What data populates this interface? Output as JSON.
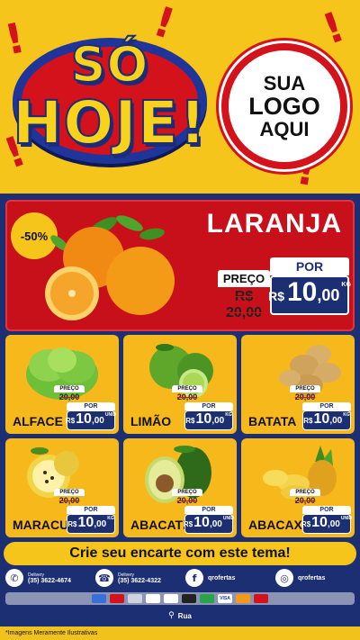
{
  "header": {
    "headline_line1": "SÓ",
    "headline_line2": "HOJE!",
    "logo_line1": "SUA",
    "logo_line2": "LOGO",
    "logo_line3": "AQUI"
  },
  "featured": {
    "name": "LARANJA",
    "discount": "-50%",
    "price_label": "PREÇO",
    "old_price": "R$ 20,00",
    "por_label": "POR",
    "currency": "R$",
    "price_int": "10",
    "price_dec": ",00",
    "unit": "KG"
  },
  "products": [
    {
      "name": "ALFACE",
      "price_label": "PREÇO",
      "old_price": "20,00",
      "por_label": "POR",
      "currency": "R$",
      "price_int": "10",
      "price_dec": ",00",
      "unit": "UNID"
    },
    {
      "name": "LIMÃO",
      "price_label": "PREÇO",
      "old_price": "20,00",
      "por_label": "POR",
      "currency": "R$",
      "price_int": "10",
      "price_dec": ",00",
      "unit": "KG"
    },
    {
      "name": "BATATA",
      "price_label": "PREÇO",
      "old_price": "20,00",
      "por_label": "POR",
      "currency": "R$",
      "price_int": "10",
      "price_dec": ",00",
      "unit": "KG"
    },
    {
      "name": "MARACUJÁ",
      "price_label": "PREÇO",
      "old_price": "20,00",
      "por_label": "POR",
      "currency": "R$",
      "price_int": "10",
      "price_dec": ",00",
      "unit": "KG"
    },
    {
      "name": "ABACATE",
      "price_label": "PREÇO",
      "old_price": "20,00",
      "por_label": "POR",
      "currency": "R$",
      "price_int": "10",
      "price_dec": ",00",
      "unit": "UNID"
    },
    {
      "name": "ABACAXI",
      "price_label": "PREÇO",
      "old_price": "20,00",
      "por_label": "POR",
      "currency": "R$",
      "price_int": "10",
      "price_dec": ",00",
      "unit": "UNID"
    }
  ],
  "cta": "Crie seu encarte com este tema!",
  "contacts": {
    "whatsapp_label": "Delivery",
    "whatsapp_value": "(35) 3622-4674",
    "phone_label": "Delivery",
    "phone_value": "(35) 3622-4322",
    "facebook_value": "qrofertas",
    "instagram_value": "qrofertas"
  },
  "payments": [
    "",
    "",
    "",
    "",
    "",
    "",
    "",
    "VISA",
    "",
    ""
  ],
  "address": "Rua",
  "disclaimer": "*Imagens Meramente Ilustrativas",
  "colors": {
    "yellow": "#f6c51c",
    "red": "#c8101a",
    "navy": "#1c2f73"
  }
}
